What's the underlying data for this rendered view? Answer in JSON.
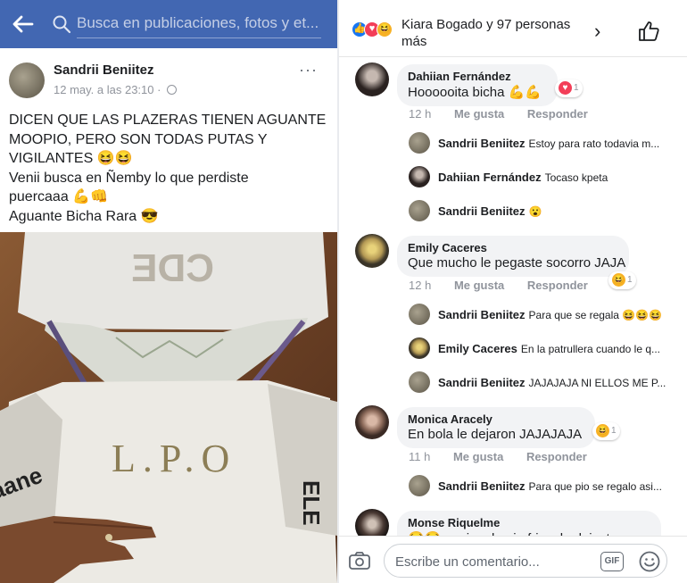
{
  "left": {
    "search_placeholder": "Busca en publicaciones, fotos y et...",
    "post": {
      "author": "Sandrii Beniitez",
      "timestamp": "12 may. a las 23:10 · ",
      "more": "···",
      "lines": [
        "DICEN QUE LAS PLAZERAS TIENEN AGUANTE",
        "MOOPIO, PERO SON TODAS PUTAS Y",
        "VIGILANTES 😆😆",
        "Venii busca en Ñemby lo que perdiste",
        "puercaaa 💪👊",
        "Aguante Bicha Rara 😎"
      ],
      "photo_texts": {
        "back_print": "CDE",
        "shirt_letters": "L.P.O",
        "sleeve_left": "aane",
        "sleeve_right": "ELE"
      }
    }
  },
  "right": {
    "reactions_text": "Kiara Bogado y 97 personas más",
    "chevron": "›",
    "comments": [
      {
        "name": "Dahiian Fernández",
        "text": "Hoooooita bicha 💪💪",
        "time": "12 h",
        "like": "Me gusta",
        "reply": "Responder",
        "badge_count": "1"
      },
      {
        "name": "Emily Caceres",
        "text": "Que mucho le pegaste socorro JAJA",
        "time": "12 h",
        "like": "Me gusta",
        "reply": "Responder",
        "badge_count": "1"
      },
      {
        "name": "Monica Aracely",
        "text": "En bola le dejaron JAJAJAJA",
        "time": "11 h",
        "like": "Me gusta",
        "reply": "Responder",
        "badge_count": "1"
      },
      {
        "name": "Monse Riquelme",
        "text": "😂😂 encima hacia frio y le dejaste en"
      }
    ],
    "replies": [
      {
        "name": "Sandrii Beniitez",
        "text": "Estoy para rato todavia m..."
      },
      {
        "name": "Dahiian Fernández",
        "text": "Tocaso kpeta"
      },
      {
        "name": "Sandrii Beniitez",
        "text": "😮"
      },
      {
        "name": "Sandrii Beniitez",
        "text": "Para que se regala 😆😆😆"
      },
      {
        "name": "Emily Caceres",
        "text": "En la patrullera cuando le q..."
      },
      {
        "name": "Sandrii Beniitez",
        "text": "JAJAJAJA NI ELLOS ME P..."
      },
      {
        "name": "Sandrii Beniitez",
        "text": "Para que pio se regalo asi..."
      }
    ],
    "composer_placeholder": "Escribe un comentario...",
    "gif_label": "GIF"
  },
  "colors": {
    "fb_blue": "#4267b2",
    "like_blue": "#1877f2",
    "love_red": "#f33e58",
    "haha_yellow": "#f7b125"
  }
}
